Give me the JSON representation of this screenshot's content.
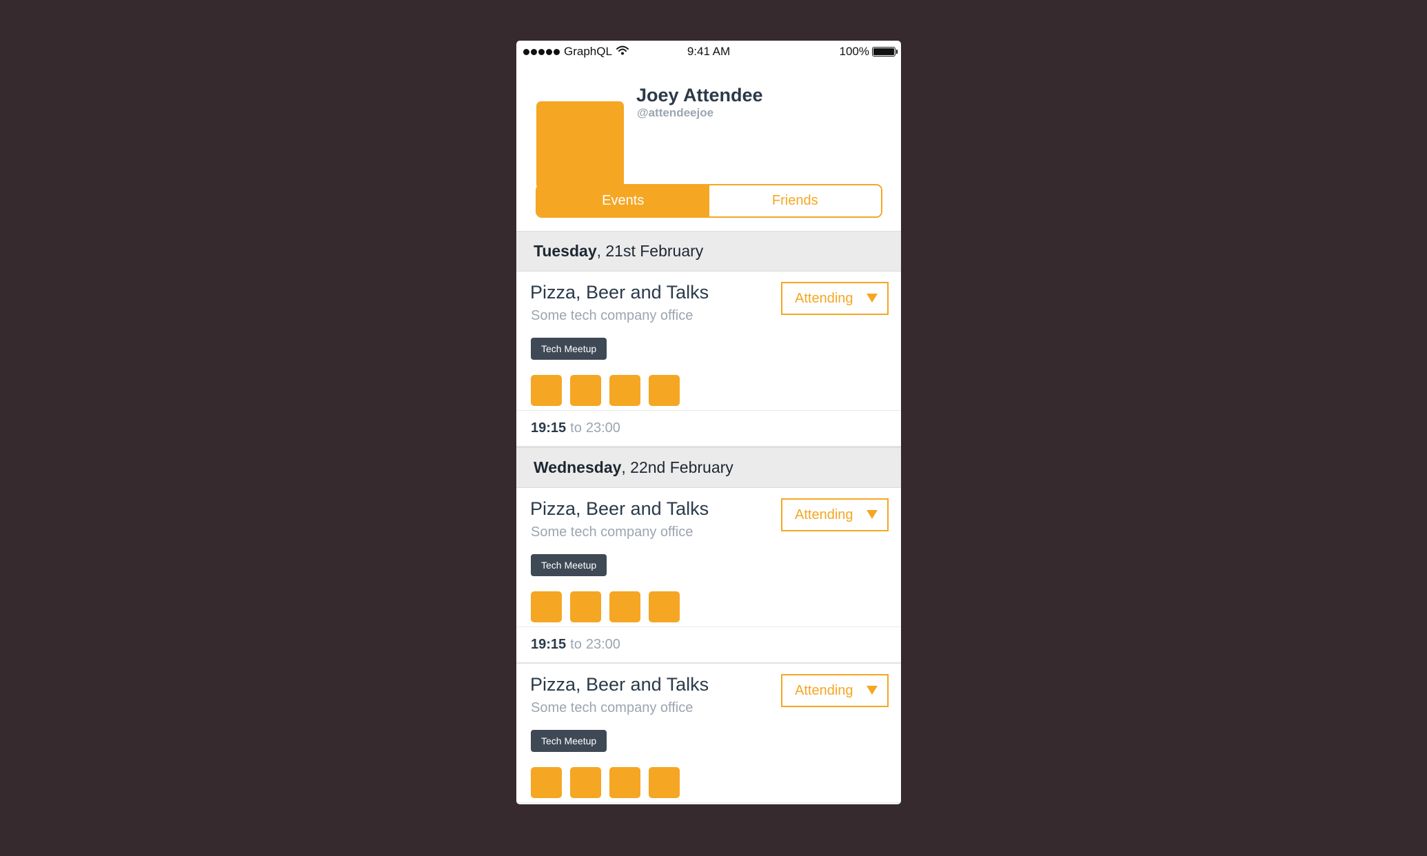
{
  "status_bar": {
    "carrier": "GraphQL",
    "time": "9:41 AM",
    "battery": "100%"
  },
  "profile": {
    "name": "Joey Attendee",
    "handle": "@attendeejoe"
  },
  "tabs": {
    "events_label": "Events",
    "friends_label": "Friends"
  },
  "days": [
    {
      "weekday": "Tuesday",
      "date": ", 21st February",
      "events": [
        {
          "title": "Pizza, Beer and Talks",
          "location": "Some tech company office",
          "tag": "Tech Meetup",
          "status": "Attending",
          "start": "19:15",
          "to": "to",
          "end": "23:00"
        }
      ]
    },
    {
      "weekday": "Wednesday",
      "date": ", 22nd February",
      "events": [
        {
          "title": "Pizza, Beer and Talks",
          "location": "Some tech company office",
          "tag": "Tech Meetup",
          "status": "Attending",
          "start": "19:15",
          "to": "to",
          "end": "23:00"
        },
        {
          "title": "Pizza, Beer and Talks",
          "location": "Some tech company office",
          "tag": "Tech Meetup",
          "status": "Attending"
        }
      ]
    }
  ],
  "colors": {
    "accent": "#f5a623",
    "background": "#372a2f",
    "text_dark": "#2b3a4a",
    "text_muted": "#9ba5b0",
    "tag_bg": "#3e4955",
    "day_header_bg": "#ebebeb"
  }
}
